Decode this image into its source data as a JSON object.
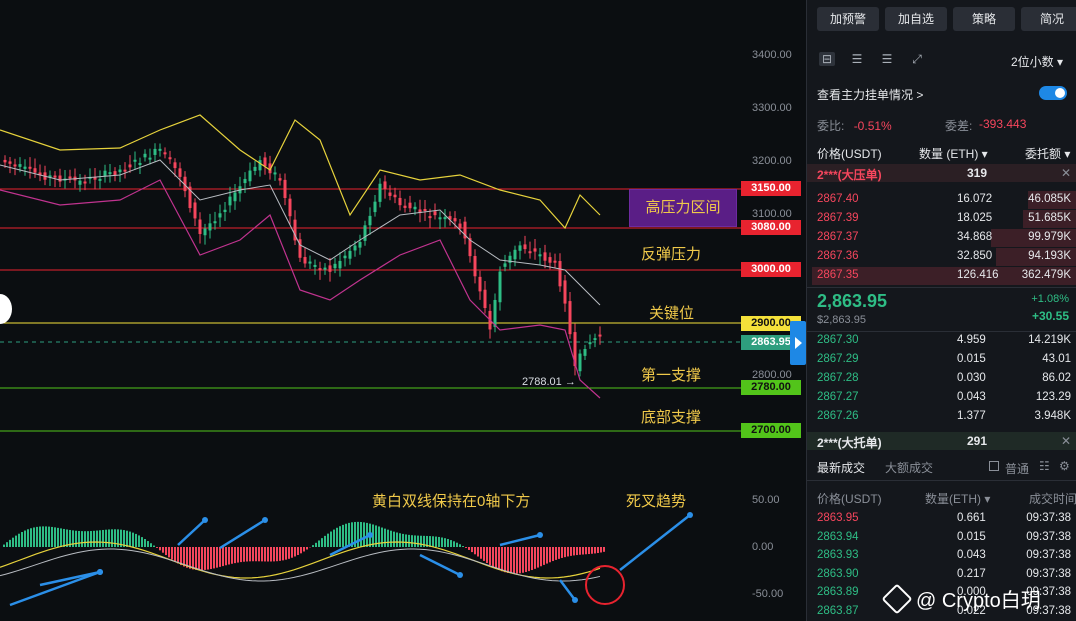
{
  "chart": {
    "axis_labels": [
      "3400.00",
      "3300.00",
      "3200.00",
      "3100.00",
      "2800.00"
    ],
    "price_tags": [
      {
        "label": "3150.00",
        "color": "#e8232f",
        "text_color": "#ffffff"
      },
      {
        "label": "3080.00",
        "color": "#e8232f",
        "text_color": "#ffffff"
      },
      {
        "label": "3000.00",
        "color": "#e8232f",
        "text_color": "#ffffff"
      },
      {
        "label": "2900.00",
        "color": "#f5e13a",
        "text_color": "#111111"
      },
      {
        "label": "2863.95",
        "color": "#2e9e7e",
        "text_color": "#ffffff"
      },
      {
        "label": "2780.00",
        "color": "#52c41a",
        "text_color": "#111111"
      },
      {
        "label": "2700.00",
        "color": "#52c41a",
        "text_color": "#111111"
      }
    ],
    "zone_high_resistance": "高压力区间",
    "zone_rebound": "反弹压力",
    "zone_key": "关键位",
    "zone_support1": "第一支撑",
    "zone_bottom": "底部支撑",
    "low_note": "2788.01 →",
    "macd_note": "黄白双线保持在0轴下方",
    "death_cross": "死叉趋势",
    "macd_axis": [
      "50.00",
      "0.00",
      "-50.00"
    ],
    "colors": {
      "up": "#2ebd85",
      "down": "#f6465d",
      "ma_yellow": "#e6d23c",
      "ma_white": "#b8bcc2",
      "band": "#c0338f"
    }
  },
  "panel": {
    "top_buttons": [
      "加预警",
      "加自选",
      "策略",
      "简况"
    ],
    "decimal": "2位小数 ▾",
    "main_orders": "查看主力挂单情况 >",
    "ratio_label": "委比:",
    "ratio_value": "-0.51%",
    "diff_label": "委差:",
    "diff_value": "-393.443",
    "headers": {
      "price": "价格(USDT)",
      "qty": "数量 (ETH) ▾",
      "total": "委托额 ▾"
    },
    "ask_big": {
      "label": "2***(大压单)",
      "value": "319",
      "close": "✕"
    },
    "asks": [
      {
        "price": "2867.40",
        "qty": "16.072",
        "total": "46.085K",
        "depth": 0.18
      },
      {
        "price": "2867.39",
        "qty": "18.025",
        "total": "51.685K",
        "depth": 0.2
      },
      {
        "price": "2867.37",
        "qty": "34.868",
        "total": "99.979K",
        "depth": 0.32
      },
      {
        "price": "2867.36",
        "qty": "32.850",
        "total": "94.193K",
        "depth": 0.3
      },
      {
        "price": "2867.35",
        "qty": "126.416",
        "total": "362.479K",
        "depth": 0.98
      }
    ],
    "mid": {
      "price": "2,863.95",
      "sub": "$2,863.95",
      "pct": "+1.08%",
      "chg": "+30.55"
    },
    "bids": [
      {
        "price": "2867.30",
        "qty": "4.959",
        "total": "14.219K"
      },
      {
        "price": "2867.29",
        "qty": "0.015",
        "total": "43.01"
      },
      {
        "price": "2867.28",
        "qty": "0.030",
        "total": "86.02"
      },
      {
        "price": "2867.27",
        "qty": "0.043",
        "total": "123.29"
      },
      {
        "price": "2867.26",
        "qty": "1.377",
        "total": "3.948K"
      }
    ],
    "bid_big": {
      "label": "2***(大托单)",
      "value": "291",
      "close": "✕"
    },
    "tabs": {
      "latest": "最新成交",
      "large": "大额成交",
      "normal": "普通"
    },
    "trade_headers": {
      "price": "价格(USDT)",
      "qty": "数量(ETH) ▾",
      "time": "成交时间"
    },
    "trades": [
      {
        "price": "2863.95",
        "qty": "0.661",
        "time": "09:37:38",
        "side": "r"
      },
      {
        "price": "2863.94",
        "qty": "0.015",
        "time": "09:37:38",
        "side": "g"
      },
      {
        "price": "2863.93",
        "qty": "0.043",
        "time": "09:37:38",
        "side": "g"
      },
      {
        "price": "2863.90",
        "qty": "0.217",
        "time": "09:37:38",
        "side": "g"
      },
      {
        "price": "2863.89",
        "qty": "0.000",
        "time": "09:37:38",
        "side": "g"
      },
      {
        "price": "2863.87",
        "qty": "0.022",
        "time": "09:37:38",
        "side": "g"
      }
    ]
  },
  "watermark": "@ Crypto白玥"
}
